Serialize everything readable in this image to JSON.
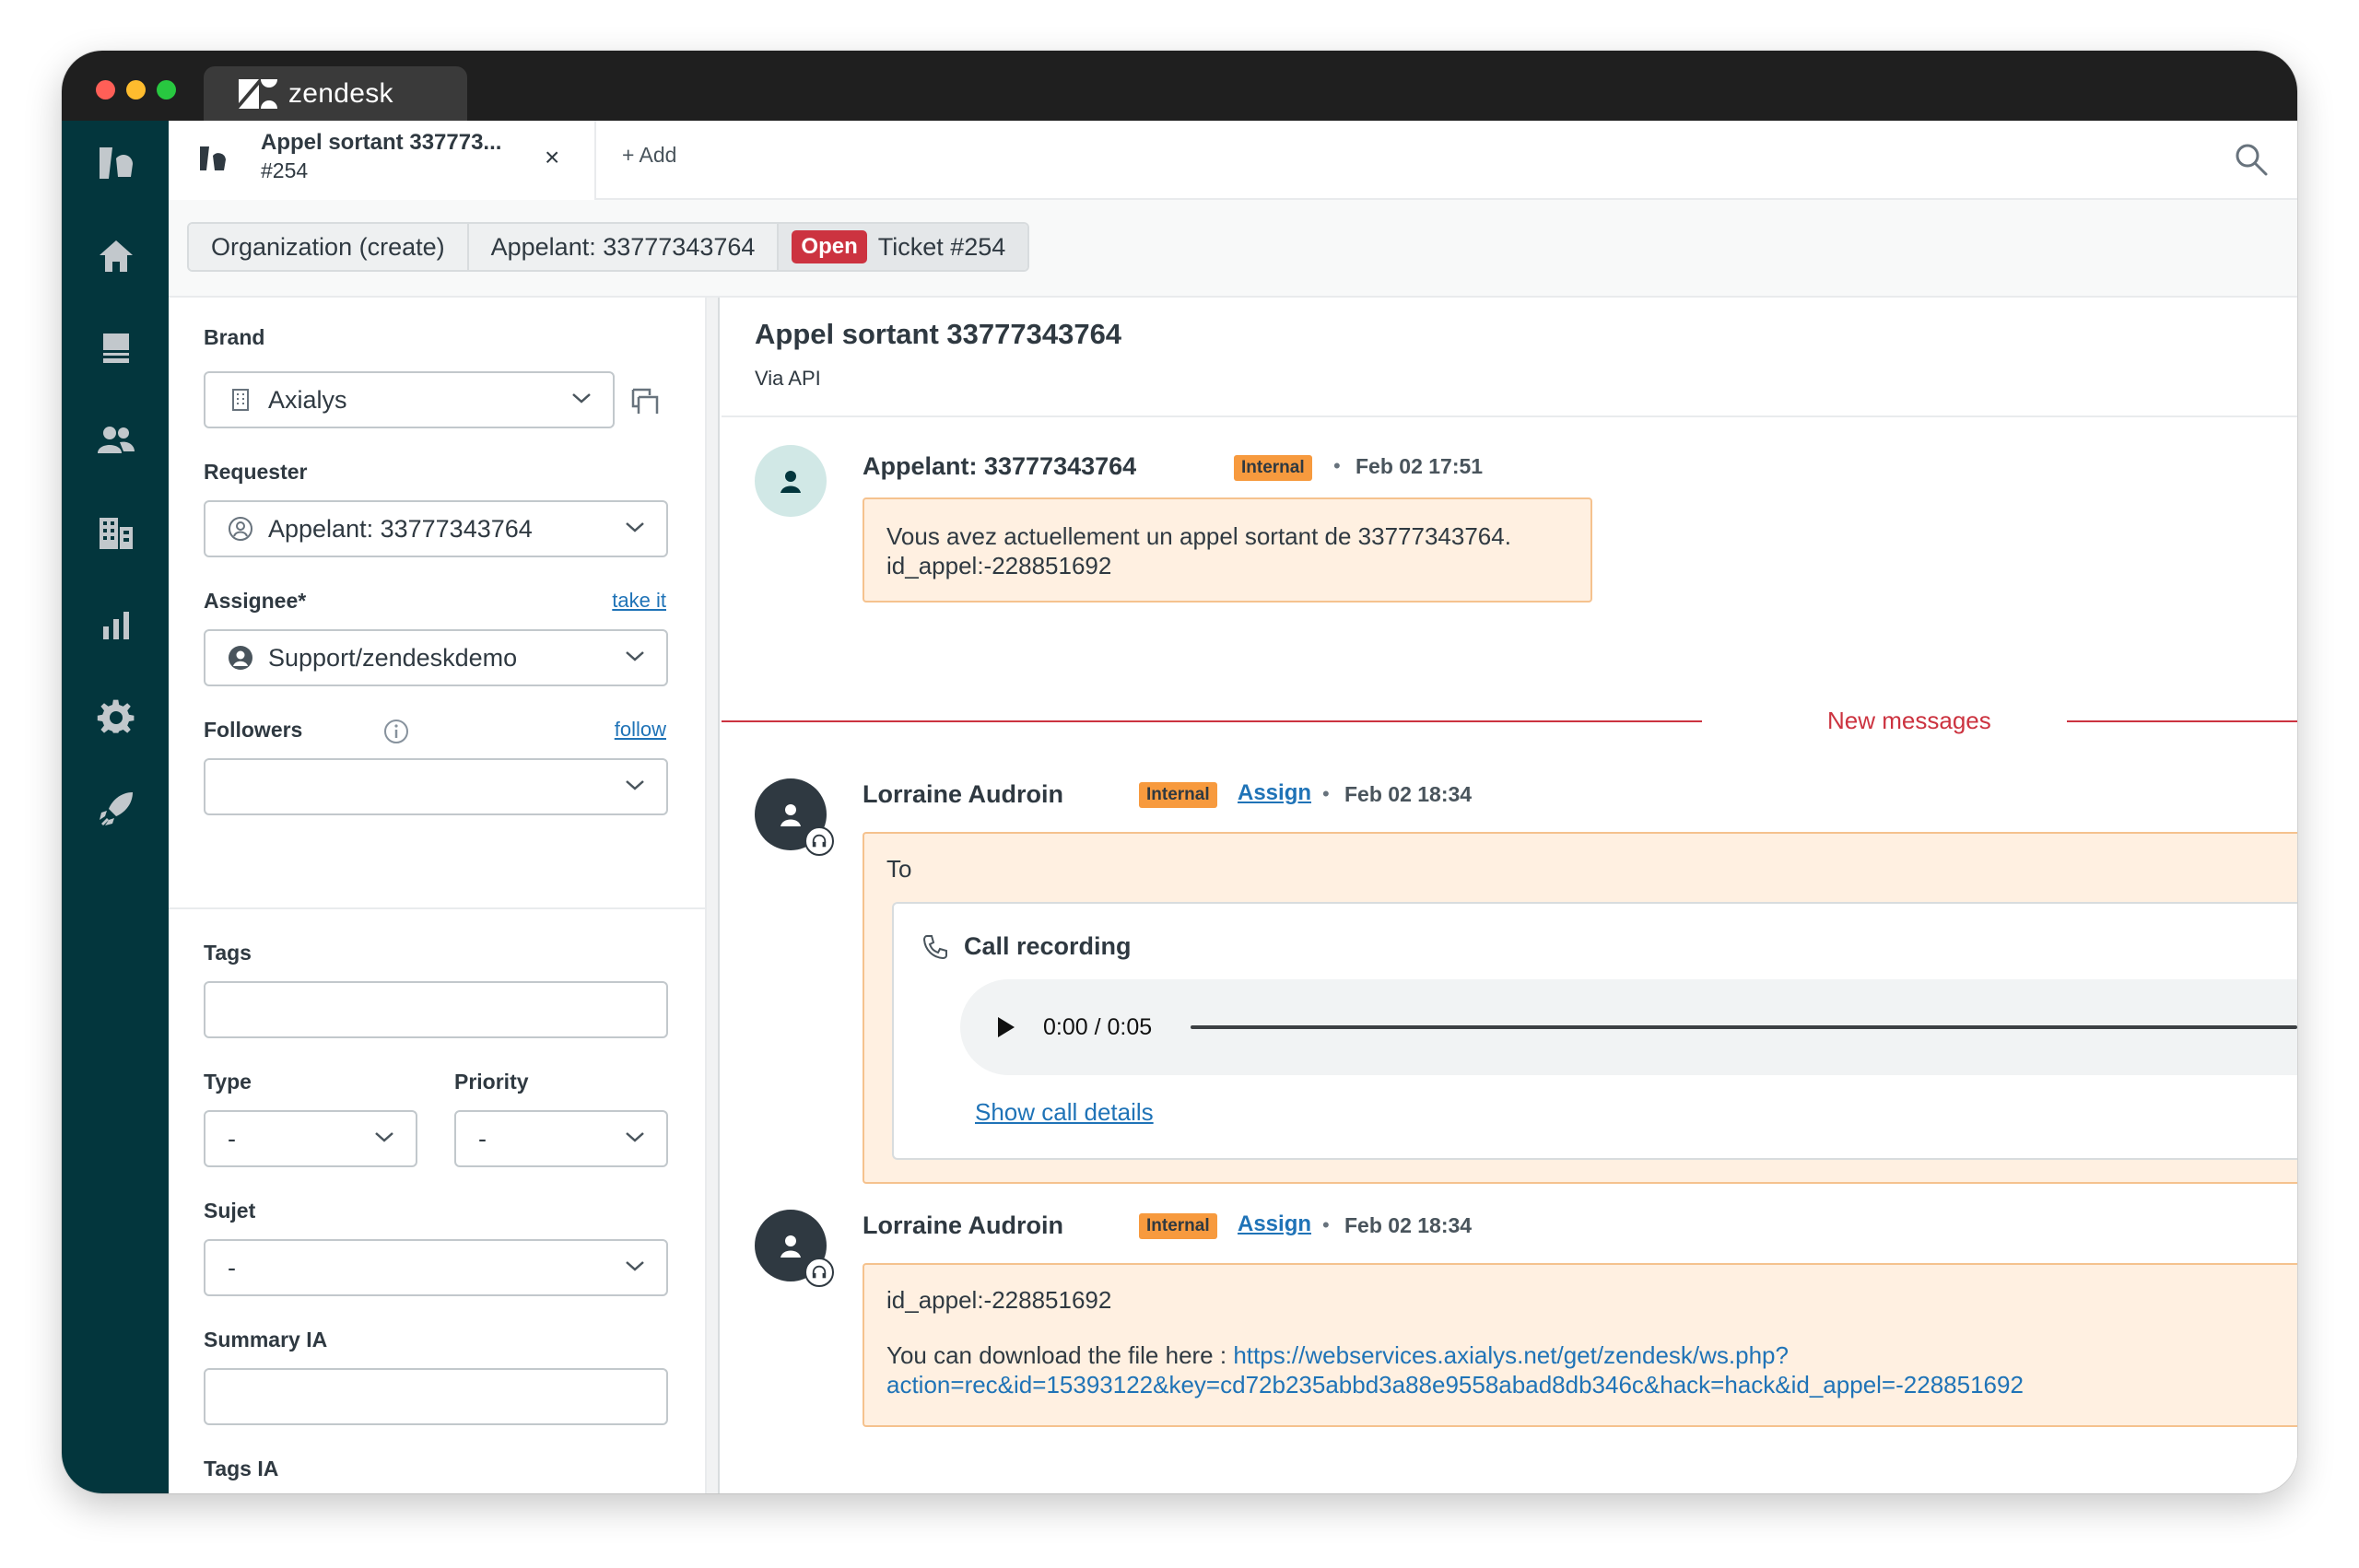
{
  "app": {
    "brand": "zendesk"
  },
  "tabs": {
    "ticket_tab": {
      "title": "Appel sortant 337773...",
      "subtitle": "#254",
      "close": "×"
    },
    "add_label": "+ Add"
  },
  "breadcrumbs": {
    "organization": "Organization (create)",
    "requester": "Appelant: 33777343764",
    "status": "Open",
    "ticket": "Ticket #254"
  },
  "sidebar": {
    "brand": {
      "label": "Brand",
      "value": "Axialys"
    },
    "requester": {
      "label": "Requester",
      "value": "Appelant: 33777343764"
    },
    "assignee": {
      "label": "Assignee*",
      "link": "take it",
      "value": "Support/zendeskdemo"
    },
    "followers": {
      "label": "Followers",
      "link": "follow",
      "value": ""
    },
    "tags": {
      "label": "Tags",
      "value": ""
    },
    "type": {
      "label": "Type",
      "value": "-"
    },
    "priority": {
      "label": "Priority",
      "value": "-"
    },
    "sujet": {
      "label": "Sujet",
      "value": "-"
    },
    "summary_ia": {
      "label": "Summary IA",
      "value": ""
    },
    "tags_ia": {
      "label": "Tags IA",
      "value": ""
    }
  },
  "conversation": {
    "title": "Appel sortant 33777343764",
    "via": "Via API",
    "new_messages_label": "New messages",
    "messages": [
      {
        "author": "Appelant: 33777343764",
        "tag": "Internal",
        "dot": "•",
        "time": "Feb 02 17:51",
        "body_line1": "Vous avez actuellement un appel sortant de 33777343764.",
        "body_line2": "id_appel:-228851692"
      },
      {
        "author": "Lorraine Audroin",
        "tag": "Internal",
        "assign": "Assign",
        "dot": "•",
        "time": "Feb 02 18:34",
        "to": "To",
        "call_title": "Call recording",
        "player_time": "0:00 / 0:05",
        "show_details": "Show call details"
      },
      {
        "author": "Lorraine Audroin",
        "tag": "Internal",
        "assign": "Assign",
        "dot": "•",
        "time": "Feb 02 18:34",
        "body_line1": "id_appel:-228851692",
        "download_prefix": "You can download the file here : ",
        "url_line1": "https://webservices.axialys.net/get/zendesk/ws.php?",
        "url_line2": "action=rec&id=15393122&key=cd72b235abbd3a88e9558abad8db346c&hack=hack&id_appel=-228851692"
      }
    ]
  },
  "colors": {
    "nav_bg": "#03363d",
    "status_open": "#cc3340",
    "internal_tag": "#f79a3e",
    "bubble_bg": "#fff0e1",
    "link": "#1f73b7"
  }
}
